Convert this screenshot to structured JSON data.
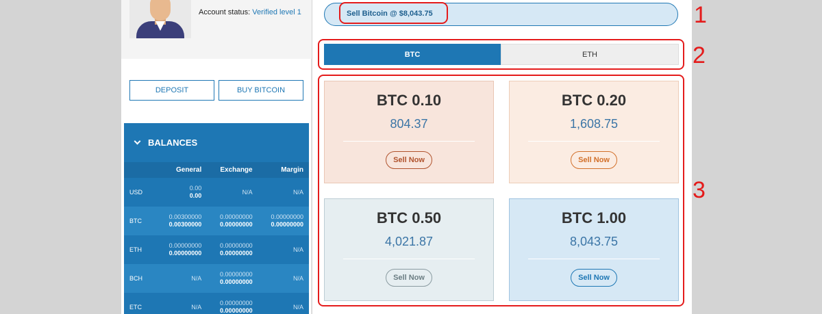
{
  "profile": {
    "status_label": "Account status:",
    "status_value": "Verified level 1"
  },
  "actions": {
    "deposit_label": "DEPOSIT",
    "buy_label": "BUY BITCOIN"
  },
  "balances": {
    "title": "BALANCES",
    "columns": [
      "",
      "General",
      "Exchange",
      "Margin"
    ],
    "rows": [
      {
        "currency": "USD",
        "general_top": "0.00",
        "general_bottom": "0.00",
        "exchange": "N/A",
        "margin": "N/A"
      },
      {
        "currency": "BTC",
        "general_top": "0.00300000",
        "general_bottom": "0.00300000",
        "exchange_top": "0.00000000",
        "exchange_bottom": "0.00000000",
        "margin_top": "0.00000000",
        "margin_bottom": "0.00000000"
      },
      {
        "currency": "ETH",
        "general_top": "0.00000000",
        "general_bottom": "0.00000000",
        "exchange_top": "0.00000000",
        "exchange_bottom": "0.00000000",
        "margin": "N/A"
      },
      {
        "currency": "BCH",
        "general": "N/A",
        "exchange_top": "0.00000000",
        "exchange_bottom": "0.00000000",
        "margin": "N/A"
      },
      {
        "currency": "ETC",
        "general": "N/A",
        "exchange_top": "0.00000000",
        "exchange_bottom": "0.00000000",
        "margin": "N/A"
      }
    ]
  },
  "sell": {
    "price_banner": "Sell Bitcoin @ $8,043.75",
    "tabs": [
      {
        "label": "BTC",
        "active": true
      },
      {
        "label": "ETH",
        "active": false
      }
    ],
    "cards": [
      {
        "amount": "BTC 0.10",
        "price": "804.37",
        "button": "Sell Now"
      },
      {
        "amount": "BTC 0.20",
        "price": "1,608.75",
        "button": "Sell Now"
      },
      {
        "amount": "BTC 0.50",
        "price": "4,021.87",
        "button": "Sell Now"
      },
      {
        "amount": "BTC 1.00",
        "price": "8,043.75",
        "button": "Sell Now"
      }
    ]
  },
  "annotations": [
    "1",
    "2",
    "3"
  ],
  "colors": {
    "primary": "#1e77b4",
    "annotation_red": "#e41b1b"
  }
}
